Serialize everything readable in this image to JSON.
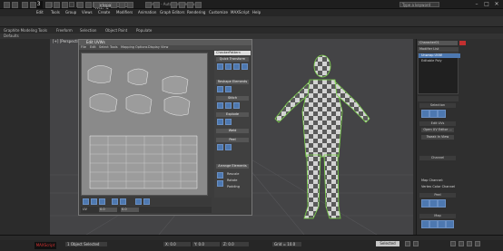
{
  "window": {
    "logo": "3",
    "workspace": "Workspace: Default",
    "title": "Untitled - Autodesk 3ds Max",
    "search_placeholder": "Type a keyword",
    "min": "–",
    "max": "□",
    "close": "✕"
  },
  "menus": [
    "Edit",
    "Tools",
    "Group",
    "Views",
    "Create",
    "Modifiers",
    "Animation",
    "Graph Editors",
    "Rendering",
    "Customize",
    "MAXScript",
    "Help"
  ],
  "ribbon": {
    "tabs": [
      "Graphite Modeling Tools",
      "Freeform",
      "Selection",
      "Object Paint",
      "Populate"
    ],
    "sub": "Defaults"
  },
  "viewport": {
    "label": "[+] [Perspective] [Realistic]",
    "background": "#444446",
    "character_colors": {
      "light": "#d2d2d2",
      "dark": "#5a5a5a",
      "edge": "#7bd34a"
    }
  },
  "uv_editor": {
    "title": "Edit UVWs",
    "menus": [
      "File",
      "Edit",
      "Select",
      "Tools",
      "Mapping",
      "Options",
      "Display",
      "View"
    ],
    "dropdown": "CheckerPattern (Checker)",
    "sections": [
      "Quick Transform",
      "Reshape Elements",
      "Stitch",
      "Explode",
      "Weld",
      "Peel",
      "Arrange Elements"
    ],
    "arrange_options": [
      "Rescale",
      "Rotate"
    ],
    "padding_label": "Padding",
    "bottom_field": "UV",
    "coords": {
      "u": "0.0",
      "v": "0.0"
    }
  },
  "command_panel": {
    "object_name": "Character01",
    "modifier_list": "Modifier List",
    "stack": [
      "Unwrap UVW",
      "Editable Poly"
    ],
    "rollouts": [
      "Selection",
      "Edit UVs",
      "Channel",
      "Peel",
      "Map"
    ],
    "buttons": [
      "Open UV Editor ...",
      "Tweak In View"
    ],
    "channel_options": [
      "Map Channel:",
      "Vertex Color Channel"
    ],
    "map_channel_value": "1"
  },
  "status": {
    "maxscript": "MAXScript",
    "selected": "1 Object Selected",
    "x": "X: 0.0",
    "y": "Y: 0.0",
    "z": "Z: 0.0",
    "grid": "Grid = 10.0",
    "auto_key": "Selected"
  }
}
